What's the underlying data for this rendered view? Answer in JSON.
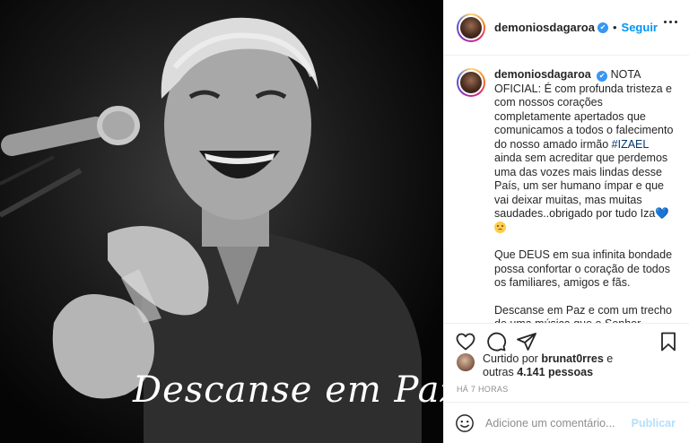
{
  "photo": {
    "caption_text": "Descanse em Paz..."
  },
  "header": {
    "username": "demoniosdagaroa",
    "verified_mark": "✔",
    "separator": "•",
    "follow_label": "Seguir",
    "more_icon": "more-horizontal-icon"
  },
  "caption": {
    "username": "demoniosdagaroa",
    "verified_mark": "✔",
    "p1_a": "NOTA OFICIAL: É com profunda tristeza e com nossos corações completamente apertados que comunicamos a todos o falecimento do nosso amado irmão",
    "hashtag": "#IZAEL",
    "p1_b": "ainda sem acreditar que perdemos uma das vozes mais lindas desse País, um ser humano ímpar e que vai deixar muitas, mas muitas saudades..obrigado por tudo Iza",
    "heart": "💙",
    "p2": "Que DEUS em sua infinita bondade possa confortar o coração de todos os familiares, amigos e fãs.",
    "p3": "Descanse em Paz e com um trecho de uma música que o Senhor gravou lindamente nos despedimos:"
  },
  "actions": {
    "like_icon": "heart-icon",
    "comment_icon": "comment-icon",
    "share_icon": "share-icon",
    "save_icon": "bookmark-icon"
  },
  "likes": {
    "prefix": "Curtido por",
    "user": "brunat0rres",
    "mid": "e",
    "line2_prefix": "outras",
    "count": "4.141 pessoas"
  },
  "timestamp": "HÁ 7 HORAS",
  "comment_bar": {
    "placeholder": "Adicione um comentário...",
    "publish_label": "Publicar"
  }
}
